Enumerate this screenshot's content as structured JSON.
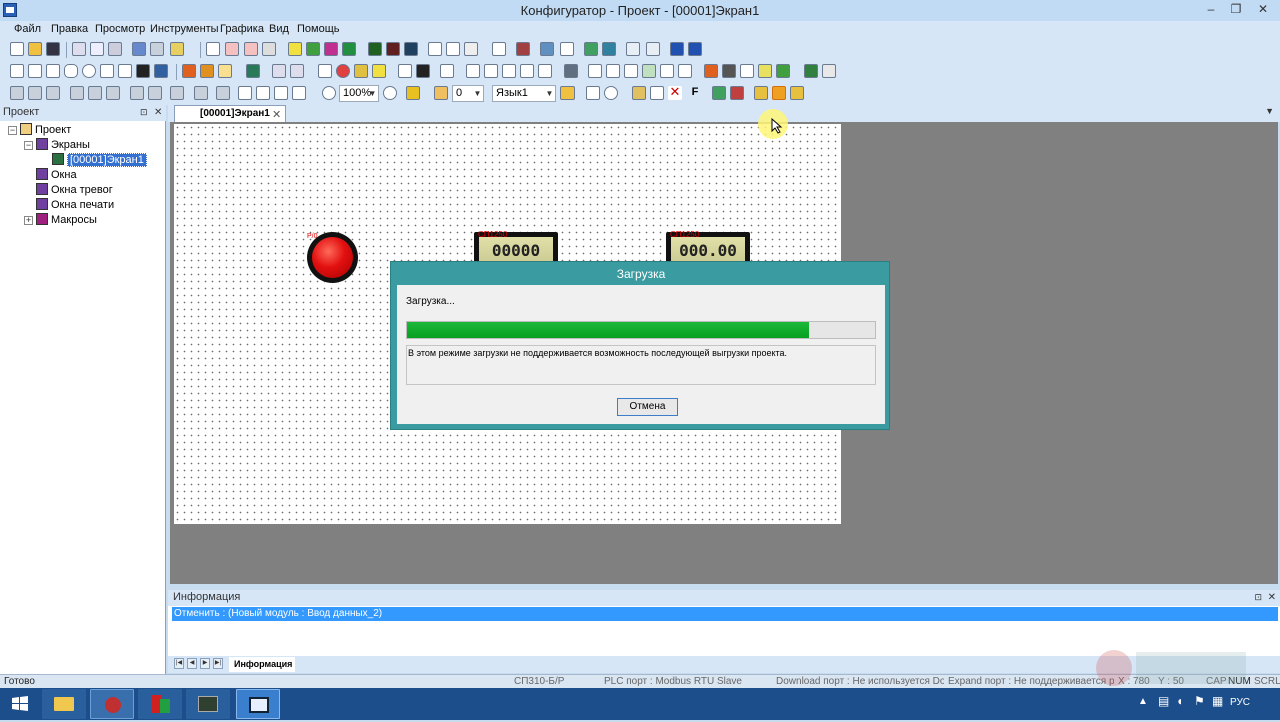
{
  "window": {
    "title": "Конфигуратор - Проект - [00001]Экран1",
    "controls": [
      "–",
      "❐",
      "✕"
    ]
  },
  "menu": {
    "items": [
      "Файл",
      "Правка",
      "Просмотр",
      "Инструменты",
      "Графика",
      "Вид",
      "Помощь"
    ]
  },
  "toolbar": {
    "zoom_value": "100%",
    "number_value": "0",
    "language_value": "Язык1",
    "f_label": "F"
  },
  "project": {
    "header": "Проект",
    "tree": {
      "root": "Проект",
      "screens": "Экраны",
      "screen1": "[00001]Экран1",
      "windows": "Окна",
      "alarm_windows": "Окна тревог",
      "print_windows": "Окна печати",
      "macros": "Макросы"
    }
  },
  "tabs": {
    "active": "[00001]Экран1"
  },
  "canvas": {
    "lamp_tag": "Р/0",
    "meter1": {
      "tag": "СП1250",
      "value": "00000"
    },
    "meter2": {
      "tag": "СП1250",
      "value": "000.00"
    }
  },
  "dialog": {
    "title": "Загрузка",
    "status": "Загрузка...",
    "progress_percent": 86,
    "message": "В этом режиме загрузки не поддерживается возможность последующей выгрузки проекта.",
    "cancel_label": "Отмена"
  },
  "info": {
    "header": "Информация",
    "row": "Отменить : (Новый модуль : Ввод данных_2)",
    "tab_label": "Информация"
  },
  "statusbar": {
    "ready": "Готово",
    "device": "СП310-Б/Р",
    "plc_port": "PLC порт : Modbus RTU Slave",
    "download_port": "Download порт : Не используется Down",
    "expand_port": "Expand порт : Не поддерживается ресу",
    "x": "X : 780",
    "y": "Y : 50",
    "cap": "CAP",
    "num": "NUM",
    "scrl": "SCRL"
  },
  "taskbar": {
    "language": "РУС"
  },
  "colors": {
    "accent": "#3a9ca0",
    "progress": "#0da62a",
    "selection": "#3399ff"
  }
}
